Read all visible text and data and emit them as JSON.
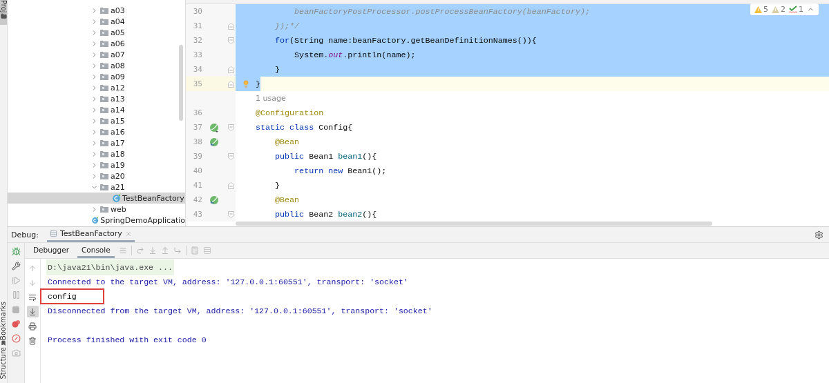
{
  "left_strip": {
    "top_tool": {
      "label": "Proj",
      "selected": true
    },
    "bottom_tools": [
      {
        "label": "Bookmarks"
      },
      {
        "label": "Structure"
      }
    ]
  },
  "project_tree": {
    "items": [
      {
        "kind": "folder",
        "label": "a03",
        "expanded": false,
        "selected": false
      },
      {
        "kind": "folder",
        "label": "a04",
        "expanded": false,
        "selected": false
      },
      {
        "kind": "folder",
        "label": "a05",
        "expanded": false,
        "selected": false
      },
      {
        "kind": "folder",
        "label": "a06",
        "expanded": false,
        "selected": false
      },
      {
        "kind": "folder",
        "label": "a07",
        "expanded": false,
        "selected": false
      },
      {
        "kind": "folder",
        "label": "a08",
        "expanded": false,
        "selected": false
      },
      {
        "kind": "folder",
        "label": "a09",
        "expanded": false,
        "selected": false
      },
      {
        "kind": "folder",
        "label": "a12",
        "expanded": false,
        "selected": false
      },
      {
        "kind": "folder",
        "label": "a13",
        "expanded": false,
        "selected": false
      },
      {
        "kind": "folder",
        "label": "a14",
        "expanded": false,
        "selected": false
      },
      {
        "kind": "folder",
        "label": "a15",
        "expanded": false,
        "selected": false
      },
      {
        "kind": "folder",
        "label": "a16",
        "expanded": false,
        "selected": false
      },
      {
        "kind": "folder",
        "label": "a17",
        "expanded": false,
        "selected": false
      },
      {
        "kind": "folder",
        "label": "a18",
        "expanded": false,
        "selected": false
      },
      {
        "kind": "folder",
        "label": "a19",
        "expanded": false,
        "selected": false
      },
      {
        "kind": "folder",
        "label": "a20",
        "expanded": false,
        "selected": false
      },
      {
        "kind": "folder",
        "label": "a21",
        "expanded": true,
        "selected": false,
        "children": [
          {
            "kind": "class",
            "label": "TestBeanFactory",
            "selected": true
          }
        ]
      },
      {
        "kind": "folder",
        "label": "web",
        "expanded": false,
        "selected": false
      },
      {
        "kind": "class",
        "label": "SpringDemoApplicatio",
        "selected": false
      }
    ]
  },
  "editor": {
    "inspections": [
      {
        "kind": "warning",
        "count": "5"
      },
      {
        "kind": "weak_warning",
        "count": "2"
      },
      {
        "kind": "typo",
        "count": "1"
      }
    ],
    "lines": [
      {
        "kind": "code",
        "number": "30",
        "selected": true,
        "current": false,
        "fold_start": false,
        "fold_end": false,
        "bulb": false,
        "tokens": [
          {
            "t": "        beanFactoryPostProcessor.postProcessBeanFactory(beanFactory);",
            "kind": "comment"
          }
        ]
      },
      {
        "kind": "code",
        "number": "31",
        "selected": true,
        "current": false,
        "fold_start": false,
        "fold_end": true,
        "bulb": false,
        "tokens": [
          {
            "t": "    });*/",
            "kind": "comment"
          }
        ]
      },
      {
        "kind": "code",
        "number": "32",
        "selected": true,
        "current": false,
        "fold_start": true,
        "fold_end": false,
        "bulb": false,
        "tokens": [
          {
            "t": "    for",
            "kind": "keyword"
          },
          {
            "t": "(String name:beanFactory.getBeanDefinitionNames()){",
            "kind": "plain"
          }
        ]
      },
      {
        "kind": "code",
        "number": "33",
        "selected": true,
        "current": false,
        "fold_start": false,
        "fold_end": false,
        "bulb": false,
        "tokens": [
          {
            "t": "        System.",
            "kind": "plain"
          },
          {
            "t": "out",
            "kind": "static"
          },
          {
            "t": ".println(name);",
            "kind": "plain"
          }
        ]
      },
      {
        "kind": "code",
        "number": "34",
        "selected": true,
        "current": false,
        "fold_start": false,
        "fold_end": true,
        "bulb": false,
        "tokens": [
          {
            "t": "    }",
            "kind": "plain"
          }
        ]
      },
      {
        "kind": "code",
        "number": "35",
        "selected": true,
        "current": true,
        "fold_start": false,
        "fold_end": true,
        "bulb": true,
        "tokens": [
          {
            "t": "}",
            "kind": "plain"
          }
        ]
      },
      {
        "kind": "inlay",
        "text": "1 usage"
      },
      {
        "kind": "code",
        "number": "36",
        "selected": false,
        "current": false,
        "fold_start": false,
        "fold_end": false,
        "bulb": false,
        "tokens": [
          {
            "t": "@Configuration",
            "kind": "annotation"
          }
        ]
      },
      {
        "kind": "code",
        "number": "37",
        "selected": false,
        "current": false,
        "fold_start": true,
        "fold_end": false,
        "bulb": false,
        "gutter_icon": {
          "kind": "bean_class"
        },
        "tokens": [
          {
            "t": "static class ",
            "kind": "keyword"
          },
          {
            "t": "Config{",
            "kind": "plain"
          }
        ]
      },
      {
        "kind": "code",
        "number": "38",
        "selected": false,
        "current": false,
        "fold_start": false,
        "fold_end": false,
        "bulb": false,
        "gutter_icon": {
          "kind": "bean_method"
        },
        "tokens": [
          {
            "t": "    @Bean",
            "kind": "annotation"
          }
        ]
      },
      {
        "kind": "code",
        "number": "39",
        "selected": false,
        "current": false,
        "fold_start": true,
        "fold_end": false,
        "bulb": false,
        "tokens": [
          {
            "t": "    public ",
            "kind": "keyword"
          },
          {
            "t": "Bean1 ",
            "kind": "plain"
          },
          {
            "t": "bean1",
            "kind": "method"
          },
          {
            "t": "(){",
            "kind": "plain"
          }
        ]
      },
      {
        "kind": "code",
        "number": "40",
        "selected": false,
        "current": false,
        "fold_start": false,
        "fold_end": false,
        "bulb": false,
        "tokens": [
          {
            "t": "        return new ",
            "kind": "keyword"
          },
          {
            "t": "Bean1();",
            "kind": "plain"
          }
        ]
      },
      {
        "kind": "code",
        "number": "41",
        "selected": false,
        "current": false,
        "fold_start": false,
        "fold_end": true,
        "bulb": false,
        "tokens": [
          {
            "t": "    }",
            "kind": "plain"
          }
        ]
      },
      {
        "kind": "code",
        "number": "42",
        "selected": false,
        "current": false,
        "fold_start": false,
        "fold_end": false,
        "bulb": false,
        "gutter_icon": {
          "kind": "bean_method"
        },
        "tokens": [
          {
            "t": "    @Bean",
            "kind": "annotation"
          }
        ]
      },
      {
        "kind": "code",
        "number": "43",
        "selected": false,
        "current": false,
        "fold_start": true,
        "fold_end": false,
        "bulb": false,
        "tokens": [
          {
            "t": "    public ",
            "kind": "keyword"
          },
          {
            "t": "Bean2 ",
            "kind": "plain"
          },
          {
            "t": "bean2",
            "kind": "method"
          },
          {
            "t": "(){",
            "kind": "plain"
          }
        ]
      }
    ]
  },
  "debug": {
    "label": "Debug:",
    "tabs": [
      {
        "label": "TestBeanFactory",
        "selected": true
      }
    ],
    "subtabs": [
      {
        "label": "Debugger",
        "selected": false
      },
      {
        "label": "Console",
        "selected": true
      }
    ],
    "debug_actions": [
      {
        "kind": "rerun",
        "disabled": false
      },
      {
        "kind": "settings",
        "disabled": false
      },
      {
        "kind": "resume",
        "disabled": true
      },
      {
        "kind": "pause",
        "disabled": true
      },
      {
        "kind": "stop",
        "disabled": true
      },
      {
        "kind": "breakpoints",
        "disabled": false
      },
      {
        "kind": "mute",
        "disabled": false
      },
      {
        "kind": "snapshot",
        "disabled": true
      }
    ],
    "console_actions": [
      {
        "kind": "up",
        "on": false
      },
      {
        "kind": "down",
        "on": false
      },
      {
        "kind": "wrap",
        "on": false
      },
      {
        "kind": "scroll_end",
        "on": true
      },
      {
        "kind": "print",
        "on": false
      },
      {
        "kind": "clear",
        "on": false
      }
    ],
    "console": [
      {
        "kind": "command",
        "text": "D:\\java21\\bin\\java.exe ...",
        "highlighted": false
      },
      {
        "kind": "system",
        "text": "Connected to the target VM, address: '127.0.0.1:60551', transport: 'socket'",
        "highlighted": false
      },
      {
        "kind": "output",
        "text": "config",
        "highlighted": true
      },
      {
        "kind": "system",
        "text": "Disconnected from the target VM, address: '127.0.0.1:60551', transport: 'socket'",
        "highlighted": false
      },
      {
        "kind": "system",
        "text": "Process finished with exit code 0",
        "highlighted": false,
        "blank_before": true
      }
    ]
  }
}
